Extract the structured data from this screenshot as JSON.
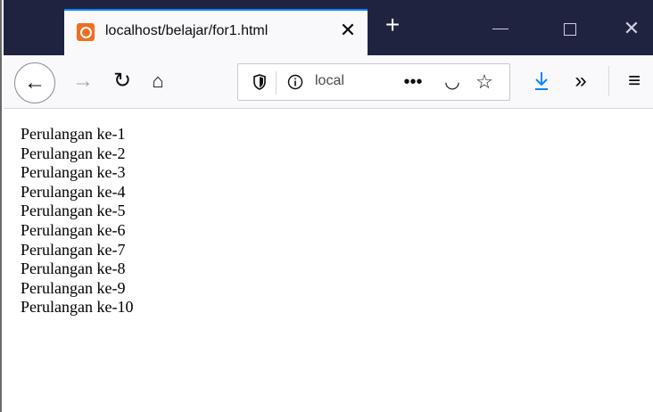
{
  "tab": {
    "title": "localhost/belajar/for1.html",
    "close": "✕"
  },
  "window": {
    "new_tab": "+",
    "minimize": "",
    "maximize": "",
    "close": "✕"
  },
  "toolbar": {
    "back": "←",
    "forward": "→",
    "reload": "↻",
    "home": "⌂",
    "url_text": "local",
    "page_actions": "•••",
    "pocket": "◡",
    "bookmark": "☆",
    "download": "↓",
    "overflow": "»",
    "menu": "≡"
  },
  "content": {
    "lines": [
      "Perulangan ke-1",
      "Perulangan ke-2",
      "Perulangan ke-3",
      "Perulangan ke-4",
      "Perulangan ke-5",
      "Perulangan ke-6",
      "Perulangan ke-7",
      "Perulangan ke-8",
      "Perulangan ke-9",
      "Perulangan ke-10"
    ]
  }
}
